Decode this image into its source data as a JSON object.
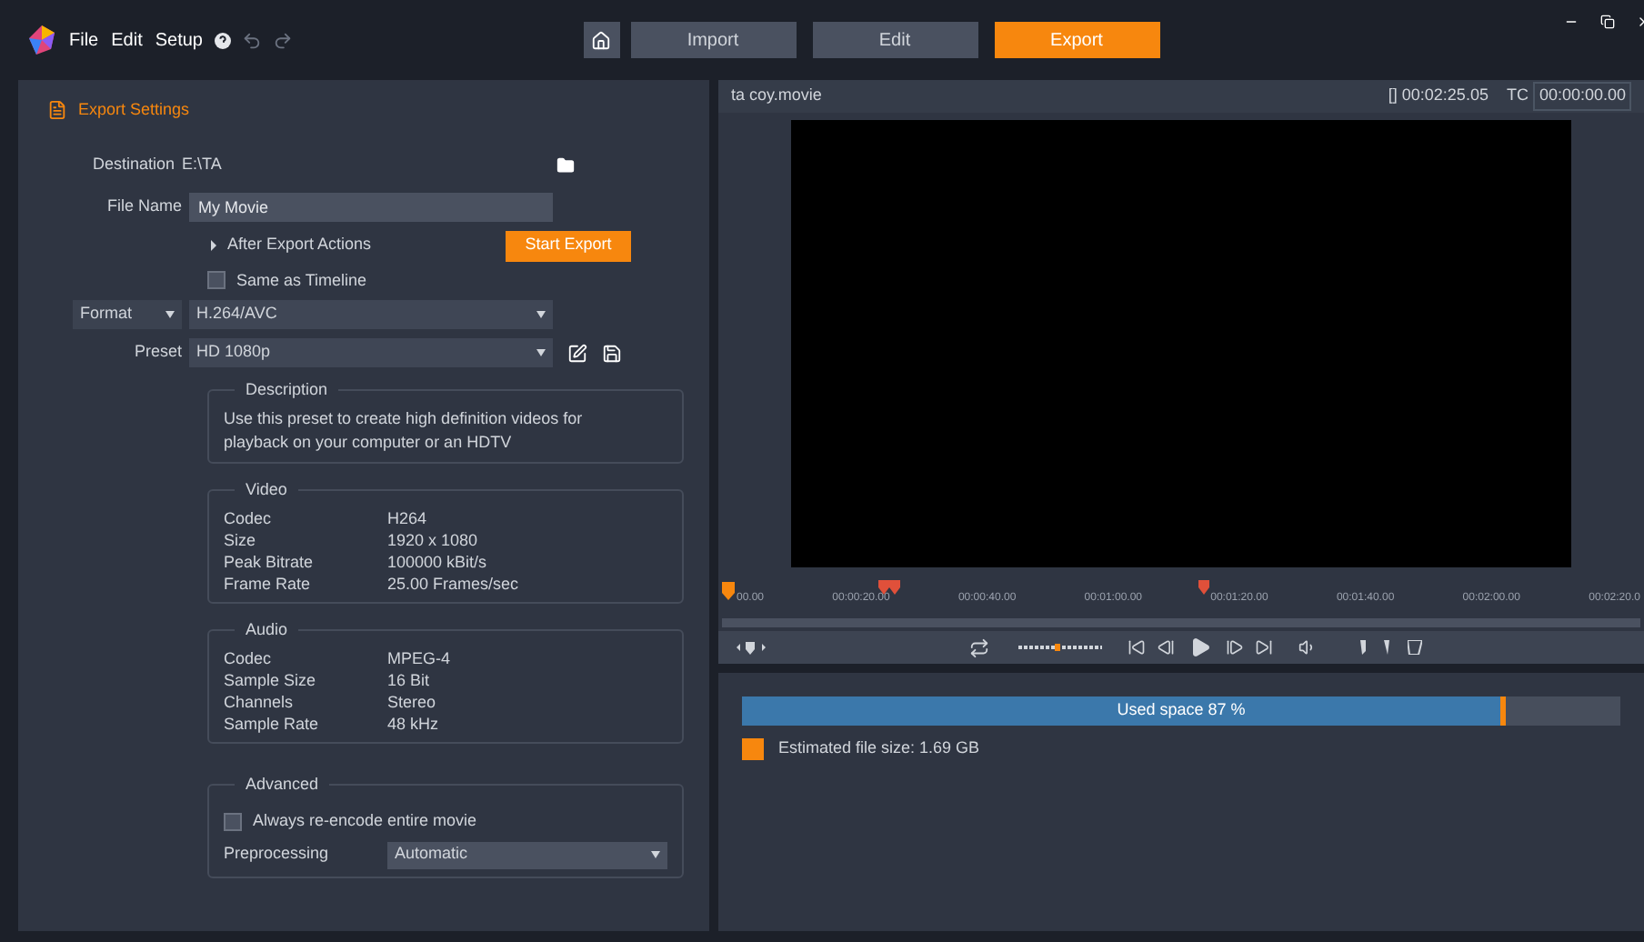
{
  "menu": [
    "File",
    "Edit",
    "Setup"
  ],
  "tabs": [
    {
      "label": "Import",
      "selected": false
    },
    {
      "label": "Edit",
      "selected": false
    },
    {
      "label": "Export",
      "selected": true
    }
  ],
  "export_settings": {
    "title": "Export Settings",
    "destination": {
      "label": "Destination",
      "value": "E:\\TA"
    },
    "file_name": {
      "label": "File Name",
      "value": "My Movie"
    },
    "after_export": {
      "label": "After Export Actions",
      "expanded": false
    },
    "start_button": "Start Export",
    "same_as_timeline": {
      "label": "Same as Timeline",
      "checked": false
    },
    "format": {
      "label": "Format",
      "value": "H.264/AVC"
    },
    "preset": {
      "label": "Preset",
      "value": "HD 1080p"
    },
    "description": {
      "title": "Description",
      "text": "Use this preset to create high definition videos for playback on your computer or an HDTV"
    },
    "video": {
      "title": "Video",
      "rows": [
        {
          "label": "Codec",
          "value": "H264"
        },
        {
          "label": "Size",
          "value": "1920 x 1080"
        },
        {
          "label": "Peak Bitrate",
          "value": "100000 kBit/s"
        },
        {
          "label": "Frame Rate",
          "value": "25.00 Frames/sec"
        }
      ]
    },
    "audio": {
      "title": "Audio",
      "rows": [
        {
          "label": "Codec",
          "value": "MPEG-4"
        },
        {
          "label": "Sample Size",
          "value": "16 Bit"
        },
        {
          "label": "Channels",
          "value": "Stereo"
        },
        {
          "label": "Sample Rate",
          "value": "48 kHz"
        }
      ]
    },
    "advanced": {
      "title": "Advanced",
      "reencode": {
        "label": "Always re-encode entire movie",
        "checked": false
      },
      "preprocessing": {
        "label": "Preprocessing",
        "value": "Automatic"
      }
    }
  },
  "preview": {
    "title": "ta coy.movie",
    "duration": "[] 00:02:25.05",
    "tc_label": "TC",
    "tc_value": "00:00:00.00",
    "ruler": [
      "00.00",
      "00:00:20.00",
      "00:00:40.00",
      "00:01:00.00",
      "00:01:20.00",
      "00:01:40.00",
      "00:02:00.00",
      "00:02:20.0"
    ]
  },
  "storage": {
    "label": "Used space 87 %",
    "level": 0.87,
    "estimate": "Estimated file size: 1.69 GB"
  }
}
